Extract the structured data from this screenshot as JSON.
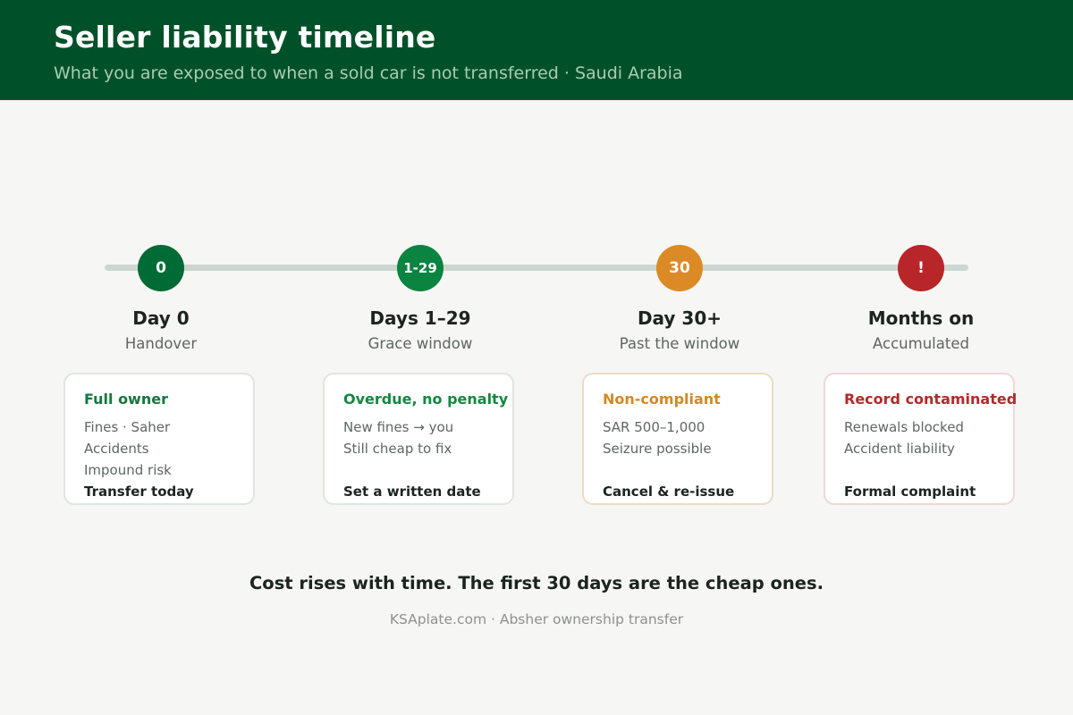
{
  "header": {
    "title": "Seller liability timeline",
    "subtitle": "What you are exposed to when a sold car is not transferred · Saudi Arabia"
  },
  "steps": [
    {
      "marker": "0",
      "title": "Day 0",
      "subtitle": "Handover",
      "color": "#006b34",
      "card": {
        "heading": "Full owner",
        "heading_color": "#14783f",
        "border_color": "#dfe6e1",
        "lines": [
          "Fines · Saher",
          "Accidents",
          "Impound risk"
        ],
        "action": "Transfer today"
      }
    },
    {
      "marker": "1-29",
      "title": "Days 1–29",
      "subtitle": "Grace window",
      "color": "#0a8440",
      "card": {
        "heading": "Overdue, no penalty",
        "heading_color": "#14883f",
        "border_color": "#dfe6e1",
        "lines": [
          "New fines → you",
          "Still cheap to fix"
        ],
        "action": "Set a written date"
      }
    },
    {
      "marker": "30",
      "title": "Day 30+",
      "subtitle": "Past the window",
      "color": "#db8a25",
      "card": {
        "heading": "Non-compliant",
        "heading_color": "#d2882a",
        "border_color": "#ecdcc3",
        "lines": [
          "SAR 500–1,000",
          "Seizure possible"
        ],
        "action": "Cancel & re-issue"
      }
    },
    {
      "marker": "!",
      "title": "Months on",
      "subtitle": "Accumulated",
      "color": "#b8262a",
      "card": {
        "heading": "Record contaminated",
        "heading_color": "#b12b2b",
        "border_color": "#efd7d7",
        "lines": [
          "Renewals blocked",
          "Accident liability"
        ],
        "action": "Formal complaint"
      }
    }
  ],
  "conclusion": "Cost rises with time. The first 30 days are the cheap ones.",
  "footer": "KSAplate.com · Absher ownership transfer"
}
